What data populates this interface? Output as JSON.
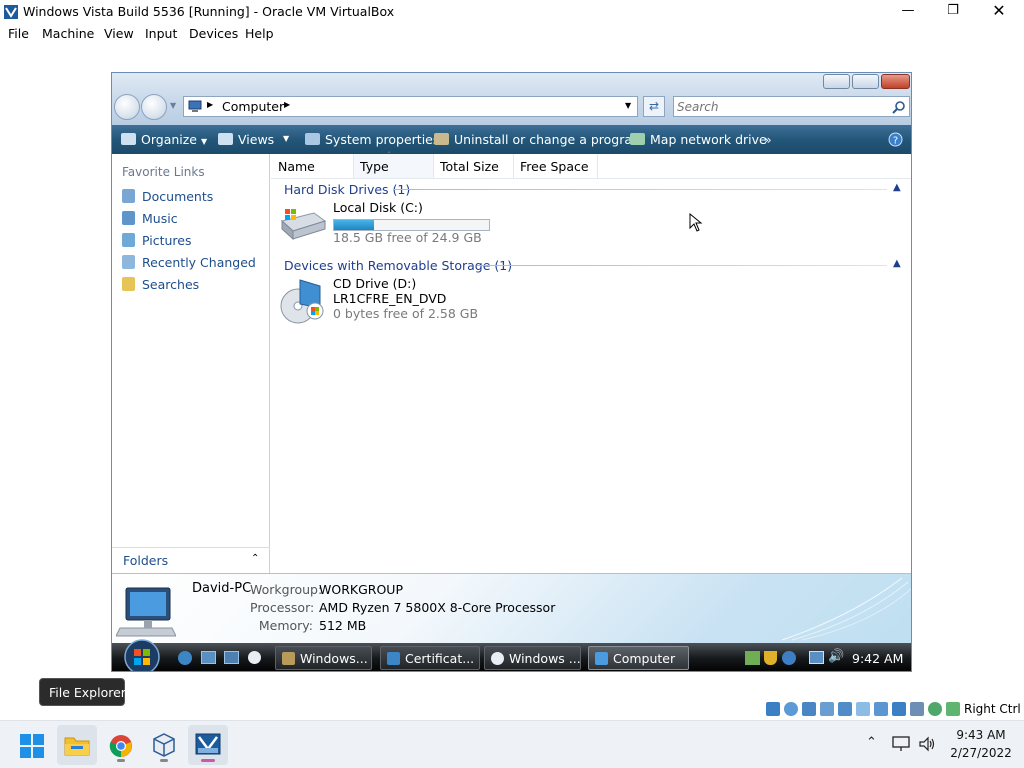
{
  "host_window": {
    "title": "Windows Vista Build 5536 [Running] - Oracle VM VirtualBox",
    "menu": [
      "File",
      "Machine",
      "View",
      "Input",
      "Devices",
      "Help"
    ],
    "right_ctrl_label": "Right Ctrl"
  },
  "explorer": {
    "address": {
      "location": "Computer"
    },
    "search": {
      "placeholder": "Search"
    },
    "toolbar": {
      "organize": "Organize",
      "views": "Views",
      "system_properties": "System properties",
      "uninstall": "Uninstall or change a program",
      "map_drive": "Map network drive",
      "more": "»"
    },
    "nav": {
      "heading": "Favorite Links",
      "links": [
        "Documents",
        "Music",
        "Pictures",
        "Recently Changed",
        "Searches"
      ],
      "folders_label": "Folders"
    },
    "columns": [
      "Name",
      "Type",
      "Total Size",
      "Free Space"
    ],
    "groups": [
      {
        "label": "Hard Disk Drives (1)",
        "drives": [
          {
            "name": "Local Disk (C:)",
            "subtitle": "",
            "detail": "18.5 GB free of 24.9 GB",
            "used_fraction": 0.26
          }
        ]
      },
      {
        "label": "Devices with Removable Storage (1)",
        "drives": [
          {
            "name": "CD Drive (D:)",
            "subtitle": "LR1CFRE_EN_DVD",
            "detail": "0 bytes free of 2.58 GB"
          }
        ]
      }
    ],
    "details": {
      "computer_name": "David-PC",
      "workgroup_label": "Workgroup:",
      "workgroup": "WORKGROUP",
      "processor_label": "Processor:",
      "processor": "AMD Ryzen 7 5800X 8-Core Processor",
      "memory_label": "Memory:",
      "memory": "512 MB"
    }
  },
  "guest_taskbar": {
    "tasks": [
      "Windows...",
      "Certificat...",
      "Windows ...",
      "Computer"
    ],
    "clock": "9:42 AM"
  },
  "tooltip": "File Explorer",
  "host_taskbar": {
    "apps": [
      "start-button",
      "file-explorer",
      "chrome",
      "virtualbox",
      "vista-vm"
    ],
    "time": "9:43 AM",
    "date": "2/27/2022"
  },
  "colors": {
    "cmdbar": "#235779",
    "link": "#1e4e8c",
    "disk_bar": "#2a9ed6"
  }
}
